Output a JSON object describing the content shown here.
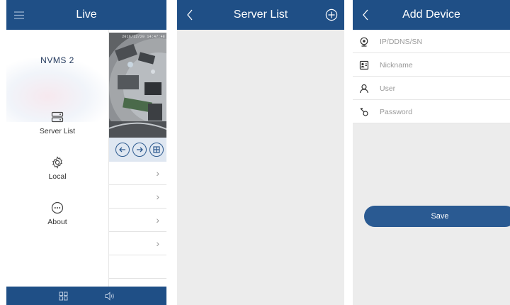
{
  "live_screen": {
    "header_title": "Live",
    "menu_icon": "hamburger-menu-icon",
    "video_timestamp": "2016/12/20 14:47:48",
    "drawer": {
      "logo": "NVMS 2",
      "items": [
        {
          "label": "Server List",
          "icon": "server-list-icon"
        },
        {
          "label": "Local",
          "icon": "gear-icon"
        },
        {
          "label": "About",
          "icon": "ellipsis-circle-icon"
        }
      ]
    },
    "ptz_icons": [
      "arrow-left-circle-icon",
      "arrow-right-circle-icon",
      "layout-grid-icon"
    ],
    "list_rows": 5,
    "bottom_icons": [
      "multi-view-grid-icon",
      "speaker-icon"
    ]
  },
  "server_list_screen": {
    "header_title": "Server List",
    "back_icon": "chevron-left-icon",
    "add_icon": "plus-circle-icon"
  },
  "add_device_screen": {
    "header_title": "Add Device",
    "back_icon": "chevron-left-icon",
    "fields": [
      {
        "placeholder": "IP/DDNS/SN",
        "icon": "webcam-icon",
        "value": ""
      },
      {
        "placeholder": "Nickname",
        "icon": "id-card-icon",
        "value": ""
      },
      {
        "placeholder": "User",
        "icon": "user-icon",
        "value": ""
      },
      {
        "placeholder": "Password",
        "icon": "key-icon",
        "value": ""
      }
    ],
    "save_label": "Save"
  },
  "colors": {
    "header_blue": "#1f4f86",
    "button_blue": "#2a5a92",
    "screen_bg": "#ececec"
  }
}
